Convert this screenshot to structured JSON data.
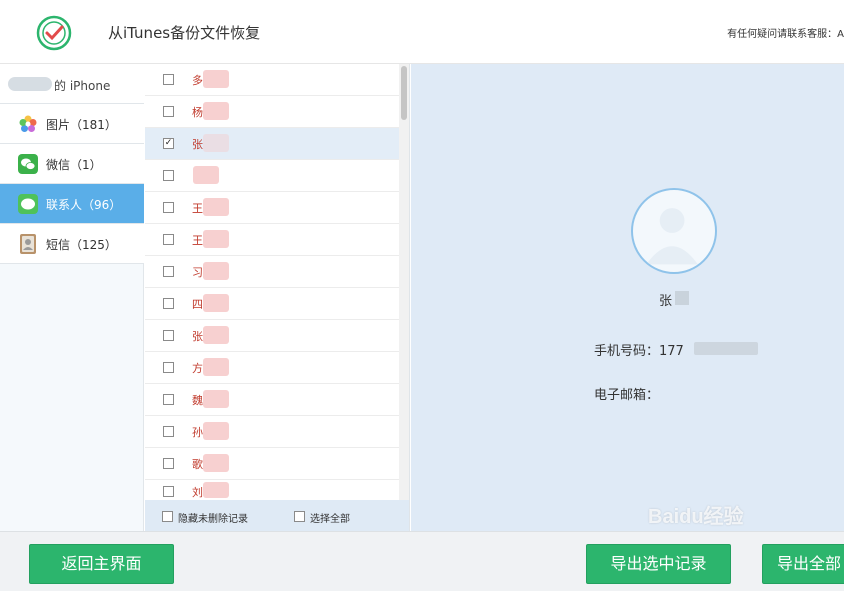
{
  "header": {
    "app_title": "从iTunes备份文件恢复",
    "support_text": "有任何疑问请联系客服：A"
  },
  "sidebar": {
    "device_label": "的 iPhone",
    "items": [
      {
        "label": "图片（181）",
        "icon": "photos-icon"
      },
      {
        "label": "微信（1）",
        "icon": "wechat-icon"
      },
      {
        "label": "联系人（96）",
        "icon": "contacts-icon",
        "active": true
      },
      {
        "label": "短信（125）",
        "icon": "messages-icon"
      }
    ]
  },
  "contacts": {
    "rows": [
      {
        "name": "多",
        "checked": false
      },
      {
        "name": "杨",
        "checked": false
      },
      {
        "name": "张",
        "checked": true
      },
      {
        "name": "",
        "checked": false
      },
      {
        "name": "王",
        "checked": false
      },
      {
        "name": "王",
        "checked": false
      },
      {
        "name": "习",
        "checked": false
      },
      {
        "name": "四",
        "checked": false
      },
      {
        "name": "张",
        "checked": false
      },
      {
        "name": "方",
        "checked": false
      },
      {
        "name": "魏",
        "checked": false
      },
      {
        "name": "孙",
        "checked": false
      },
      {
        "name": "歌",
        "checked": false
      },
      {
        "name": "刘",
        "checked": false
      }
    ],
    "hide_undeleted_label": "隐藏未删除记录",
    "select_all_label": "选择全部"
  },
  "detail": {
    "name": "张",
    "phone_label": "手机号码：177",
    "email_label": "电子邮箱："
  },
  "footer": {
    "back_label": "返回主界面",
    "export_selected_label": "导出选中记录",
    "export_all_label": "导出全部"
  },
  "watermark": "Baidu经验",
  "colors": {
    "accent": "#5aaee8",
    "button": "#2cb56d",
    "detail_bg": "#dfeaf6"
  }
}
